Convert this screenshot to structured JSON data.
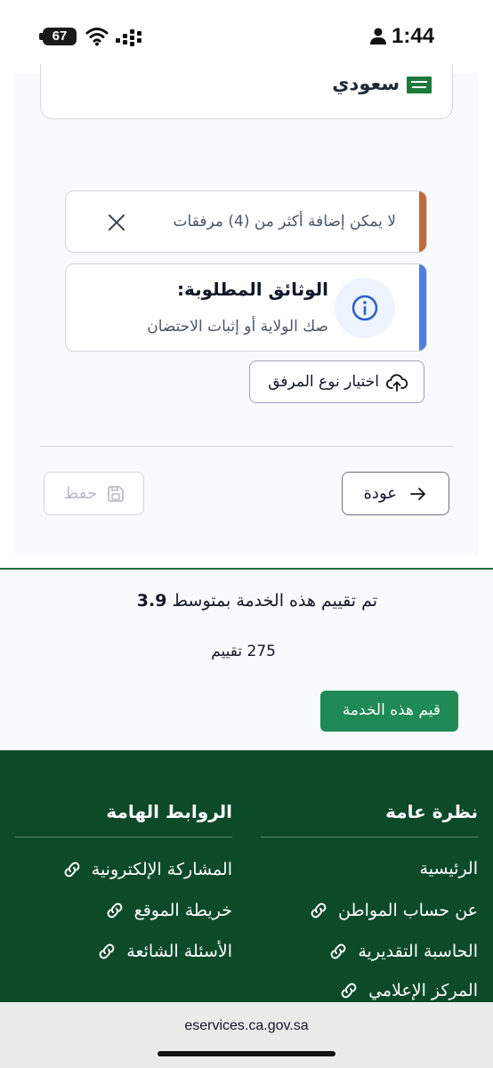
{
  "status_bar": {
    "battery": "67",
    "time": "1:44",
    "icons": [
      "battery-icon",
      "wifi-icon",
      "cellular-icon",
      "person-icon"
    ]
  },
  "form": {
    "nationality": "سعودي",
    "nationality_flag": "saudi-flag-icon",
    "limit_alert": "لا يمكن إضافة أكثر من (4) مرفقات",
    "docs_alert": {
      "title": "الوثائق المطلوبة:",
      "subtitle": "صك الولاية أو إثبات الاحتضان"
    },
    "attach_button": "اختيار نوع المرفق",
    "save_button": "حفظ",
    "back_button": "عودة"
  },
  "rating": {
    "text_prefix": "تم تقييم هذه الخدمة بمتوسط",
    "average": "3.9",
    "count_text": "275 تقييم",
    "rate_button": "قيم هذه الخدمة"
  },
  "footer": {
    "overview": {
      "title": "نظرة عامة",
      "links": [
        "الرئيسية",
        "عن حساب المواطن",
        "الحاسبة التقديرية",
        "المركز الإعلامي"
      ]
    },
    "important_links": {
      "title": "الروابط الهامة",
      "links": [
        "المشاركة الإلكترونية",
        "خريطة الموقع",
        "الأسئلة الشائعة"
      ]
    }
  },
  "browser": {
    "url": "eservices.ca.gov.sa"
  },
  "colors": {
    "brand_green": "#1f8a55",
    "footer_green": "#0d4a2a",
    "warning_stripe": "#c0693e",
    "info_stripe": "#4f7fe0"
  }
}
